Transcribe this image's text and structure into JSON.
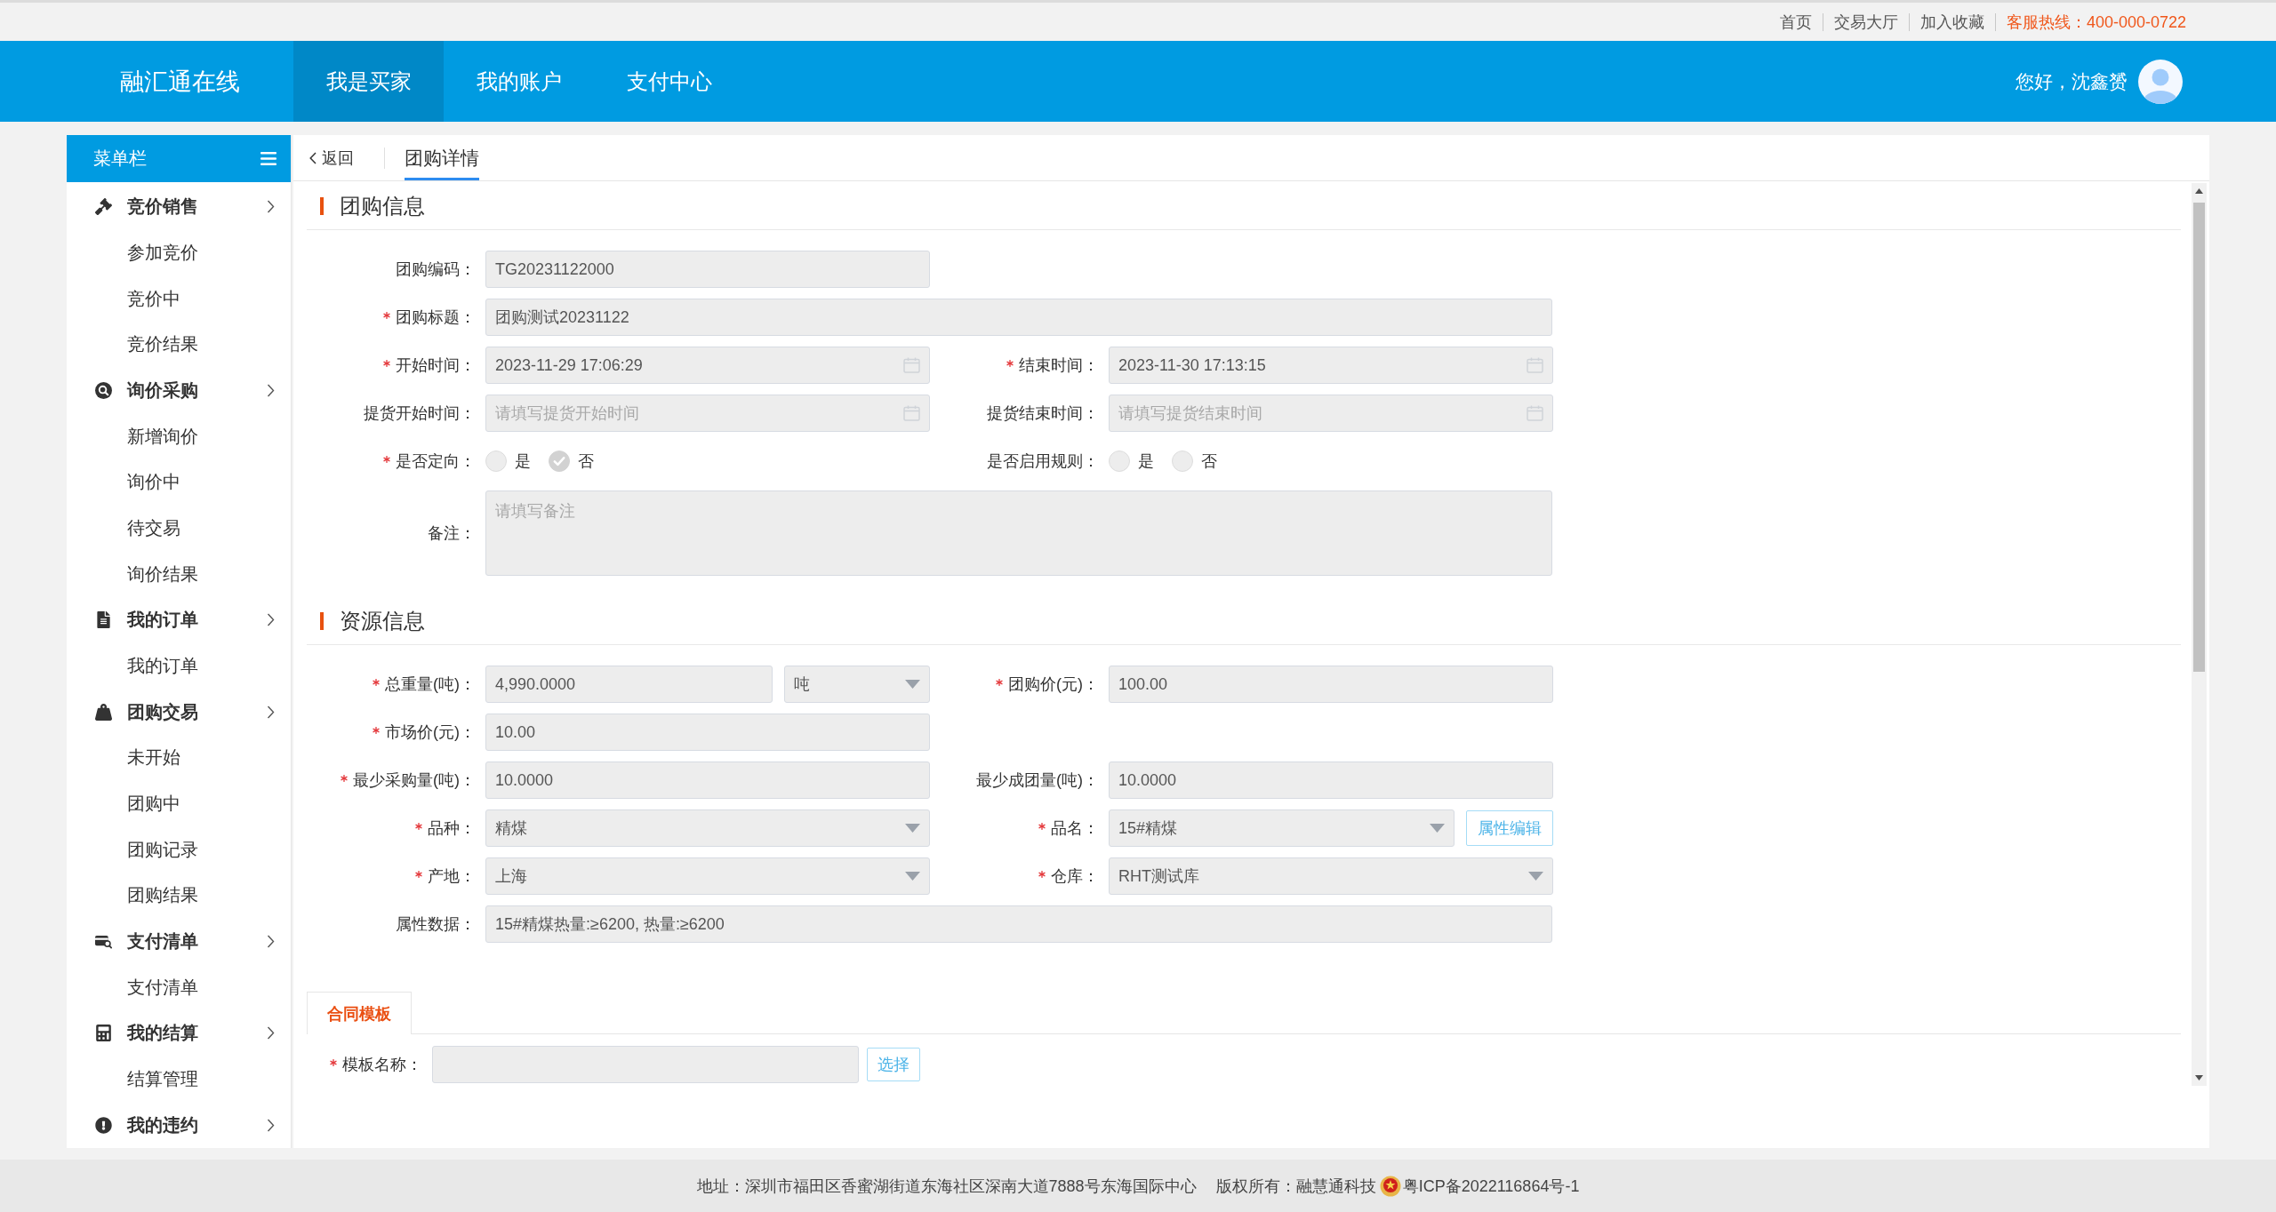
{
  "top_bar": {
    "links": [
      "首页",
      "交易大厅",
      "加入收藏"
    ],
    "hotline": "客服热线：400-000-0722"
  },
  "header": {
    "logo": "融汇通在线",
    "nav": [
      {
        "label": "我是买家",
        "selected": true
      },
      {
        "label": "我的账户",
        "selected": false
      },
      {
        "label": "支付中心",
        "selected": false
      }
    ],
    "greeting": "您好，沈鑫赟"
  },
  "sidebar": {
    "title": "菜单栏",
    "groups": [
      {
        "label": "竞价销售",
        "children": [
          {
            "label": "参加竞价"
          },
          {
            "label": "竞价中"
          },
          {
            "label": "竞价结果"
          }
        ]
      },
      {
        "label": "询价采购",
        "children": [
          {
            "label": "新增询价"
          },
          {
            "label": "询价中"
          },
          {
            "label": "待交易"
          },
          {
            "label": "询价结果"
          }
        ]
      },
      {
        "label": "我的订单",
        "children": [
          {
            "label": "我的订单"
          }
        ]
      },
      {
        "label": "团购交易",
        "children": [
          {
            "label": "未开始"
          },
          {
            "label": "团购中"
          },
          {
            "label": "团购记录"
          },
          {
            "label": "团购结果"
          }
        ]
      },
      {
        "label": "支付清单",
        "children": [
          {
            "label": "支付清单"
          }
        ]
      },
      {
        "label": "我的结算",
        "children": [
          {
            "label": "结算管理"
          }
        ]
      },
      {
        "label": "我的违约"
      }
    ]
  },
  "breadcrumb": {
    "back": "返回",
    "tabs": [
      {
        "label": "团购详情",
        "selected": true
      }
    ]
  },
  "form": {
    "disabled": true,
    "sections": [
      {
        "title": "团购信息",
        "rows": [
          [
            {
              "kind": "text",
              "label": "团购编码：",
              "required": false,
              "value": "TG20231122000"
            }
          ],
          [
            {
              "kind": "longtext",
              "label": "团购标题：",
              "required": true,
              "value": "团购测试20231122"
            }
          ],
          [
            {
              "kind": "date",
              "label": "开始时间：",
              "required": true,
              "value": "2023-11-29 17:06:29"
            },
            {
              "kind": "date",
              "label": "结束时间：",
              "required": true,
              "value": "2023-11-30 17:13:15"
            }
          ],
          [
            {
              "kind": "date",
              "label": "提货开始时间：",
              "required": false,
              "placeholder": "请填写提货开始时间"
            },
            {
              "kind": "date",
              "label": "提货结束时间：",
              "required": false,
              "placeholder": "请填写提货结束时间"
            }
          ],
          [
            {
              "kind": "radio",
              "label": "是否定向：",
              "required": true,
              "options": [
                {
                  "label": "是",
                  "selected": false
                },
                {
                  "label": "否",
                  "selected": true
                }
              ]
            },
            {
              "kind": "radio",
              "label": "是否启用规则：",
              "required": false,
              "options": [
                {
                  "label": "是",
                  "selected": false
                },
                {
                  "label": "否",
                  "selected": false
                }
              ]
            }
          ],
          [
            {
              "kind": "textarea",
              "label": "备注：",
              "required": false,
              "placeholder": "请填写备注"
            }
          ]
        ]
      },
      {
        "title": "资源信息",
        "rows": [
          [
            {
              "kind": "quantity",
              "label": "总重量(吨)：",
              "required": true,
              "value": "4,990.0000",
              "unit": "吨"
            },
            {
              "kind": "text",
              "label": "团购价(元)：",
              "required": true,
              "value": "100.00"
            }
          ],
          [
            {
              "kind": "text",
              "label": "市场价(元)：",
              "required": true,
              "value": "10.00"
            }
          ],
          [
            {
              "kind": "text",
              "label": "最少采购量(吨)：",
              "required": true,
              "value": "10.0000"
            },
            {
              "kind": "text",
              "label": "最少成团量(吨)：",
              "required": false,
              "value": "10.0000"
            }
          ],
          [
            {
              "kind": "select",
              "label": "品种：",
              "required": true,
              "value": "精煤"
            },
            {
              "kind": "picker",
              "label": "品名：",
              "required": true,
              "value": "15#精煤",
              "button": "属性编辑"
            }
          ],
          [
            {
              "kind": "select",
              "label": "产地：",
              "required": true,
              "value": "上海"
            },
            {
              "kind": "select",
              "label": "仓库：",
              "required": true,
              "value": "RHT测试库"
            }
          ],
          [
            {
              "kind": "longtext",
              "label": "属性数据：",
              "required": false,
              "value": "15#精煤热量:≥6200, 热量:≥6200"
            }
          ]
        ]
      }
    ],
    "contract": {
      "tabs": [
        {
          "label": "合同模板",
          "selected": true
        }
      ],
      "rows": [
        [
          {
            "kind": "chooser",
            "label": "模板名称：",
            "required": true,
            "button": "选择"
          }
        ]
      ]
    }
  },
  "footer": {
    "address": "地址：深圳市福田区香蜜湖街道东海社区深南大道7888号东海国际中心",
    "copyright": "版权所有：融慧通科技",
    "icp": "粤ICP备2022116864号-1"
  }
}
